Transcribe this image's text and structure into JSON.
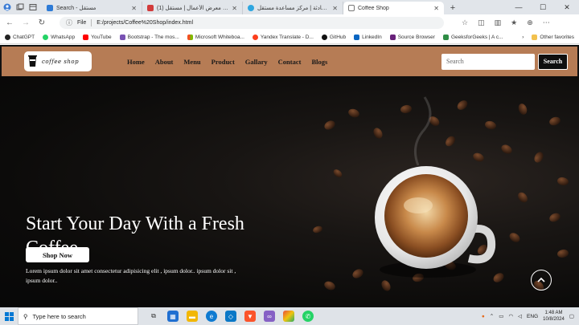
{
  "browser": {
    "tabs": [
      {
        "title": "Search - مستقل",
        "fav_color": "#2e7bd6",
        "active": false
      },
      {
        "title": "(1) إضافة معرض الأعمال | مستقل",
        "fav_color": "#d23b3b",
        "active": false
      },
      {
        "title": "المحادثة | مركز مساعدة مستقل",
        "fav_color": "#2ea6e0",
        "active": false
      },
      {
        "title": "Coffee Shop",
        "fav_color": "#7a7a7a",
        "active": true
      }
    ],
    "address": {
      "info_label": "File",
      "url": "E:/projects/Coffee%20Shop/index.html"
    },
    "bookmarks": [
      {
        "label": "ChatGPT",
        "color": "#222222"
      },
      {
        "label": "WhatsApp",
        "color": "#25d366"
      },
      {
        "label": "YouTube",
        "color": "#ff0000"
      },
      {
        "label": "Bootstrap - The mos...",
        "color": "#7952b3"
      },
      {
        "label": "Microsoft Whiteboa...",
        "color": "#f25022"
      },
      {
        "label": "Yandex Translate - D...",
        "color": "#fc3f1d"
      },
      {
        "label": "GitHub",
        "color": "#111111"
      },
      {
        "label": "LinkedIn",
        "color": "#0a66c2"
      },
      {
        "label": "Source Browser",
        "color": "#68217a"
      },
      {
        "label": "GeeksforGeeks | A c...",
        "color": "#2f8d46"
      }
    ],
    "other_favorites": "Other favorites"
  },
  "site": {
    "logo_text": "coffee shop",
    "menu": [
      "Home",
      "About",
      "Menu",
      "Product",
      "Gallary",
      "Contact",
      "Blogs"
    ],
    "search_placeholder": "Search",
    "search_button": "Search",
    "hero": {
      "title": "Start Your Day With a Fresh Coffee",
      "text": "Lorem ipsum dolor sit amet consectetur adipisicing elit , ipsum dolor.. ipsum dolor sit , ipsum dolor..",
      "button": "Shop Now"
    }
  },
  "taskbar": {
    "search_placeholder": "Type here to search",
    "language": "ENG",
    "time": "1:48 AM",
    "date": "10/8/2024"
  }
}
